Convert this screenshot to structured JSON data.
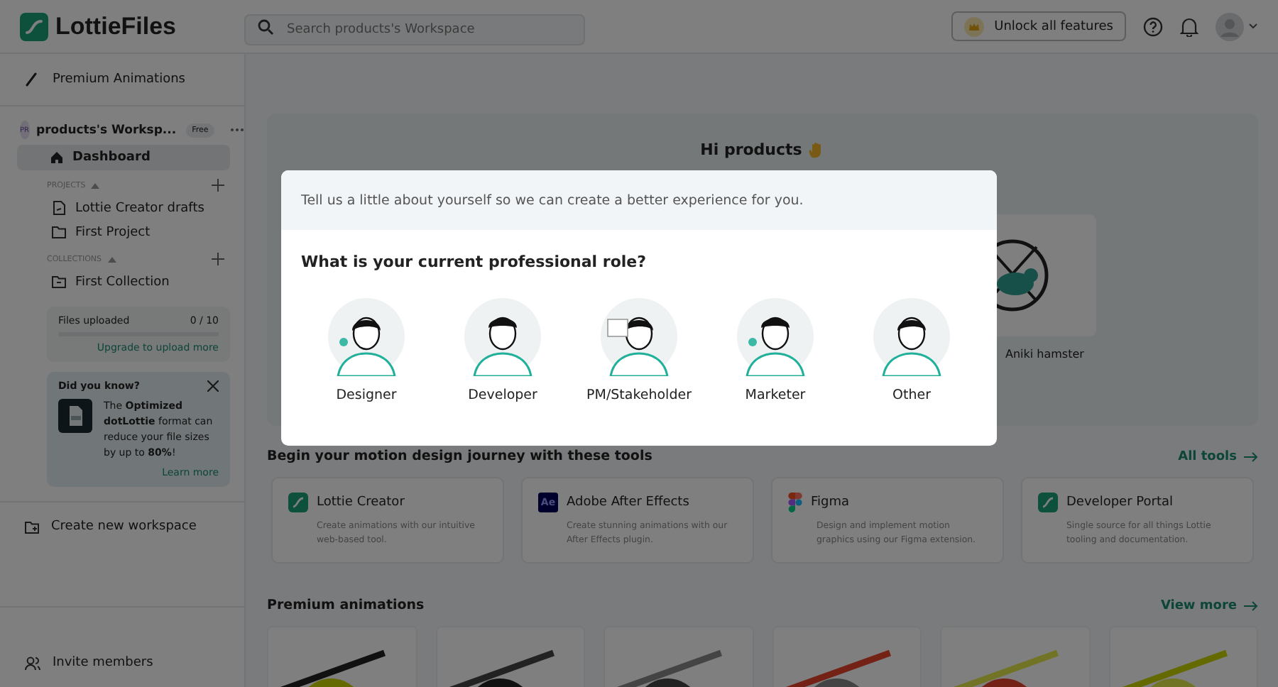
{
  "header": {
    "logo": "LottieFiles",
    "search": {
      "placeholder": "Search products's Workspace"
    },
    "unlock_button": "Unlock all features"
  },
  "sidebar": {
    "premium_link": "Premium Animations",
    "workspace": {
      "avatar": "PR",
      "name": "products's Worksp...",
      "badge": "Free"
    },
    "nav": [
      {
        "label": "Dashboard",
        "selected": true
      }
    ],
    "projects": {
      "heading": "PROJECTS",
      "items": [
        {
          "label": "Lottie Creator drafts",
          "kind": "drafts"
        },
        {
          "label": "First Project",
          "kind": "folder"
        }
      ]
    },
    "collections": {
      "heading": "COLLECTIONS",
      "items": [
        {
          "label": "First Collection",
          "kind": "collection"
        }
      ]
    },
    "usage": {
      "label": "Files uploaded",
      "count": "0 / 10",
      "level": 0,
      "link": "Upgrade to upload more"
    },
    "tip": {
      "title": "Did you know?",
      "text": "The **Optimized dotLottie** format can reduce your file sizes by up to **80%**!",
      "link": "Learn more"
    },
    "create_workspace": "Create new workspace",
    "invite": "Invite members"
  },
  "welcome": {
    "greeting": "Hi products",
    "card_label": "Aniki hamster"
  },
  "tools": {
    "heading": "Begin your motion design journey with these tools",
    "link": "All tools",
    "items": [
      {
        "kind": "creator",
        "name": "Lottie Creator",
        "description": "Create animations with our intuitive web-based tool."
      },
      {
        "kind": "aftereffects",
        "icon_label": "Ae",
        "name": "Adobe After Effects",
        "description": "Create stunning animations with our After Effects plugin."
      },
      {
        "kind": "figma",
        "name": "Figma",
        "description": "Design and implement motion graphics using our Figma extension."
      },
      {
        "kind": "portal",
        "name": "Developer Portal",
        "description": "Single source for all things Lottie tooling and documentation."
      }
    ]
  },
  "premium": {
    "heading": "Premium animations",
    "link": "View more"
  },
  "modal": {
    "intro": "Tell us a little about yourself so we can create a better experience for you.",
    "question": "What is your current professional role?",
    "roles": [
      {
        "label": "Designer"
      },
      {
        "label": "Developer"
      },
      {
        "label": "PM/Stakeholder"
      },
      {
        "label": "Marketer"
      },
      {
        "label": "Other"
      }
    ]
  }
}
